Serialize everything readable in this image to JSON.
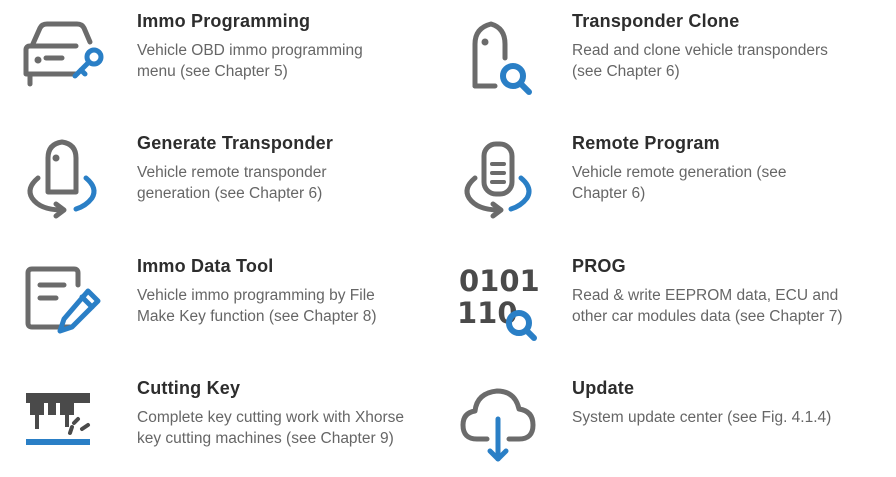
{
  "colors": {
    "icon_gray": "#6b6b6b",
    "icon_blue": "#2a7fc6",
    "title": "#2d2d2d",
    "desc": "#666666"
  },
  "items": [
    {
      "icon": "car-key-icon",
      "title": "Immo Programming",
      "desc_line1": "Vehicle OBD immo programming",
      "desc_line2": "menu (see Chapter 5)"
    },
    {
      "icon": "transponder-search-icon",
      "title": "Transponder Clone",
      "desc_line1": "Read and clone vehicle transponders",
      "desc_line2": "(see Chapter 6)"
    },
    {
      "icon": "transponder-rotate-icon",
      "title": "Generate Transponder",
      "desc_line1": "Vehicle remote transponder",
      "desc_line2": "generation (see Chapter 6)"
    },
    {
      "icon": "remote-rotate-icon",
      "title": "Remote Program",
      "desc_line1": "Vehicle remote generation (see",
      "desc_line2": "Chapter 6)"
    },
    {
      "icon": "document-pen-icon",
      "title": "Immo Data Tool",
      "desc_line1": "Vehicle immo programming by File",
      "desc_line2": "Make Key function (see Chapter 8)"
    },
    {
      "icon": "binary-search-icon",
      "icon_text_top": "0101",
      "icon_text_bottom": "110",
      "title": "PROG",
      "desc_line1": "Read & write EEPROM data, ECU and",
      "desc_line2": "other car modules data (see Chapter 7)"
    },
    {
      "icon": "key-cutting-machine-icon",
      "title": "Cutting Key",
      "desc_line1": "Complete key cutting work with Xhorse",
      "desc_line2": "key cutting machines (see Chapter 9)"
    },
    {
      "icon": "cloud-download-icon",
      "title": "Update",
      "desc_line1": "System update center (see Fig. 4.1.4)",
      "desc_line2": ""
    }
  ]
}
